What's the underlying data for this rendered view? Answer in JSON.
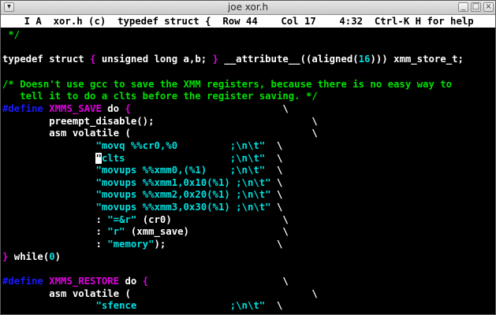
{
  "window": {
    "title": "joe xor.h"
  },
  "status_bar": {
    "text": "    I A  xor.h (c)  typedef struct {  Row 44    Col 17    4:32  Ctrl-K H for help"
  },
  "editor": {
    "lines": [
      [
        {
          "t": " */",
          "c": "g"
        }
      ],
      [],
      [
        {
          "t": "typedef struct ",
          "c": "w"
        },
        {
          "t": "{",
          "c": "m"
        },
        {
          "t": " unsigned long a,b; ",
          "c": "w"
        },
        {
          "t": "}",
          "c": "m"
        },
        {
          "t": " __attribute__((aligned(",
          "c": "w"
        },
        {
          "t": "16",
          "c": "c"
        },
        {
          "t": "))) xmm_store_t;",
          "c": "w"
        }
      ],
      [],
      [
        {
          "t": "/* Doesn't use gcc to save the XMM registers, because there is no easy way to",
          "c": "g"
        }
      ],
      [
        {
          "t": "   tell it to do a clts before the register saving. */",
          "c": "g"
        }
      ],
      [
        {
          "t": "#define ",
          "c": "b"
        },
        {
          "t": "XMMS_SAVE",
          "c": "m"
        },
        {
          "t": " do ",
          "c": "w"
        },
        {
          "t": "{",
          "c": "m"
        },
        {
          "t": "                          \\",
          "c": "w"
        }
      ],
      [
        {
          "t": "        preempt_disable();                           \\",
          "c": "w"
        }
      ],
      [
        {
          "t": "        asm volatile (                               \\",
          "c": "w"
        }
      ],
      [
        {
          "t": "                ",
          "c": "w"
        },
        {
          "t": "\"movq %%cr0,%0         ;\\n\\t\"",
          "c": "c"
        },
        {
          "t": "  \\",
          "c": "w"
        }
      ],
      [
        {
          "t": "                ",
          "c": "w"
        },
        {
          "t": "\"",
          "c": "cursor"
        },
        {
          "t": "clts                  ;\\n\\t\"",
          "c": "c"
        },
        {
          "t": "  \\",
          "c": "w"
        }
      ],
      [
        {
          "t": "                ",
          "c": "w"
        },
        {
          "t": "\"movups %%xmm0,(%1)    ;\\n\\t\"",
          "c": "c"
        },
        {
          "t": "  \\",
          "c": "w"
        }
      ],
      [
        {
          "t": "                ",
          "c": "w"
        },
        {
          "t": "\"movups %%xmm1,0x10(%1) ;\\n\\t\"",
          "c": "c"
        },
        {
          "t": " \\",
          "c": "w"
        }
      ],
      [
        {
          "t": "                ",
          "c": "w"
        },
        {
          "t": "\"movups %%xmm2,0x20(%1) ;\\n\\t\"",
          "c": "c"
        },
        {
          "t": " \\",
          "c": "w"
        }
      ],
      [
        {
          "t": "                ",
          "c": "w"
        },
        {
          "t": "\"movups %%xmm3,0x30(%1) ;\\n\\t\"",
          "c": "c"
        },
        {
          "t": " \\",
          "c": "w"
        }
      ],
      [
        {
          "t": "                : ",
          "c": "w"
        },
        {
          "t": "\"=&r\"",
          "c": "c"
        },
        {
          "t": " (cr0)                   \\",
          "c": "w"
        }
      ],
      [
        {
          "t": "                : ",
          "c": "w"
        },
        {
          "t": "\"r\"",
          "c": "c"
        },
        {
          "t": " (xmm_save)                \\",
          "c": "w"
        }
      ],
      [
        {
          "t": "                : ",
          "c": "w"
        },
        {
          "t": "\"memory\"",
          "c": "c"
        },
        {
          "t": ");                   \\",
          "c": "w"
        }
      ],
      [
        {
          "t": "}",
          "c": "m"
        },
        {
          "t": " while(",
          "c": "w"
        },
        {
          "t": "0",
          "c": "c"
        },
        {
          "t": ")",
          "c": "w"
        }
      ],
      [],
      [
        {
          "t": "#define ",
          "c": "b"
        },
        {
          "t": "XMMS_RESTORE",
          "c": "m"
        },
        {
          "t": " do ",
          "c": "w"
        },
        {
          "t": "{",
          "c": "m"
        },
        {
          "t": "                       \\",
          "c": "w"
        }
      ],
      [
        {
          "t": "        asm volatile (                               \\",
          "c": "w"
        }
      ],
      [
        {
          "t": "                ",
          "c": "w"
        },
        {
          "t": "\"sfence                ;\\n\\t\"",
          "c": "c"
        },
        {
          "t": "  \\",
          "c": "w"
        }
      ]
    ]
  }
}
